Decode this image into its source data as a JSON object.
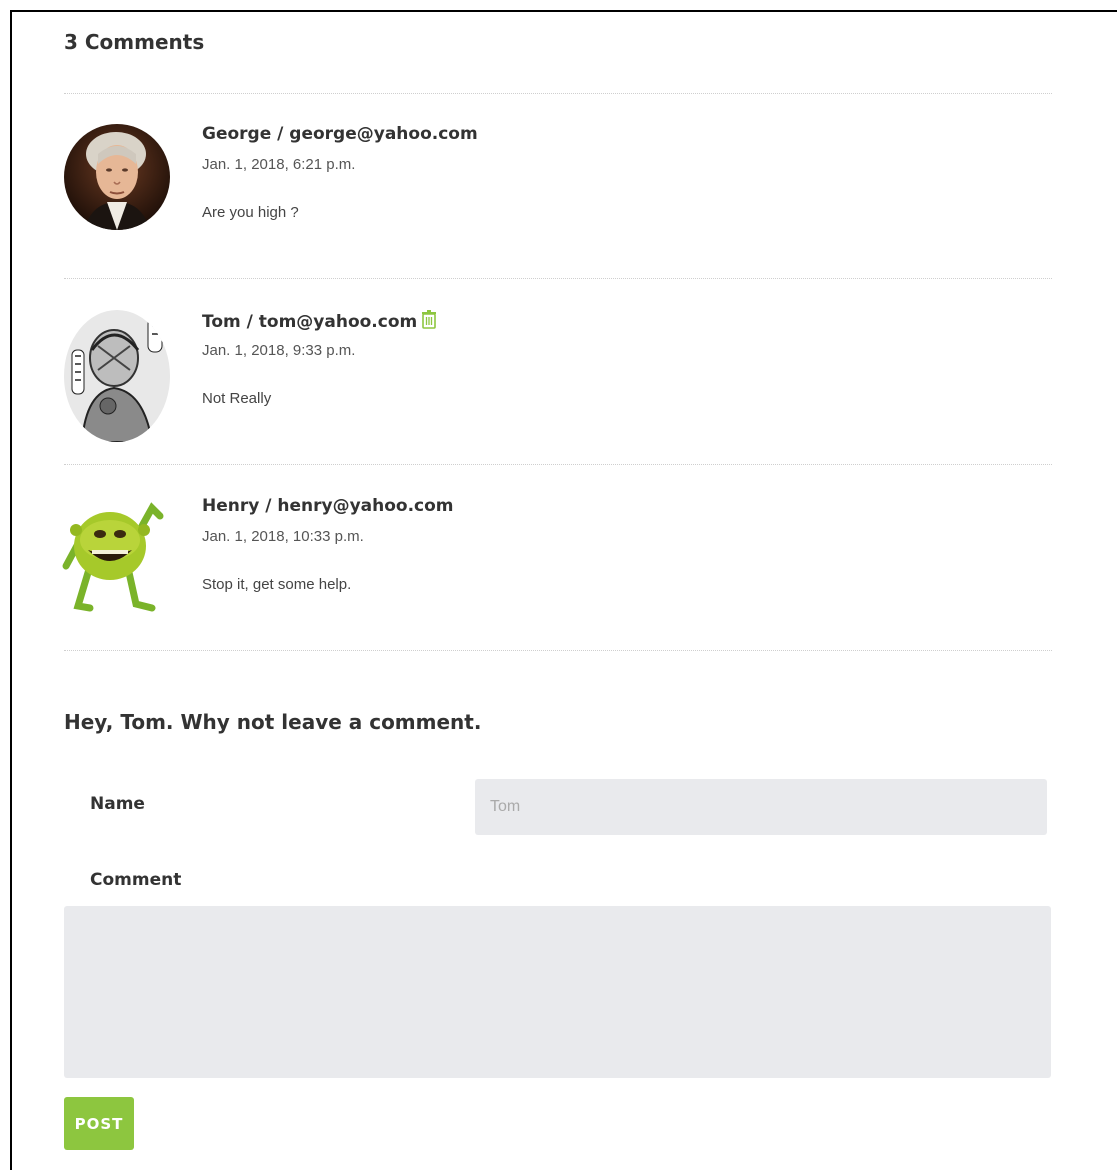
{
  "comments_section": {
    "count_heading": "3 Comments",
    "comments": [
      {
        "author": "George / george@yahoo.com",
        "date": "Jan. 1, 2018, 6:21 p.m.",
        "text": "Are you high ?",
        "avatar_icon": "george-washington-portrait-avatar",
        "has_delete": false
      },
      {
        "author": "Tom / tom@yahoo.com",
        "date": "Jan. 1, 2018, 9:33 p.m.",
        "text": "Not Really",
        "avatar_icon": "manga-sketch-avatar",
        "has_delete": true,
        "delete_icon": "trash-icon"
      },
      {
        "author": "Henry / henry@yahoo.com",
        "date": "Jan. 1, 2018, 10:33 p.m.",
        "text": "Stop it, get some help.",
        "avatar_icon": "green-cartoon-creature-avatar",
        "has_delete": false
      }
    ]
  },
  "comment_form": {
    "heading": "Hey, Tom. Why not leave a comment.",
    "name_label": "Name",
    "name_placeholder": "Tom",
    "comment_label": "Comment",
    "comment_value": "",
    "post_button": "POST"
  },
  "colors": {
    "accent": "#8dc63f",
    "input_bg": "#e9eaed",
    "delete_icon": "#8dc63f"
  }
}
